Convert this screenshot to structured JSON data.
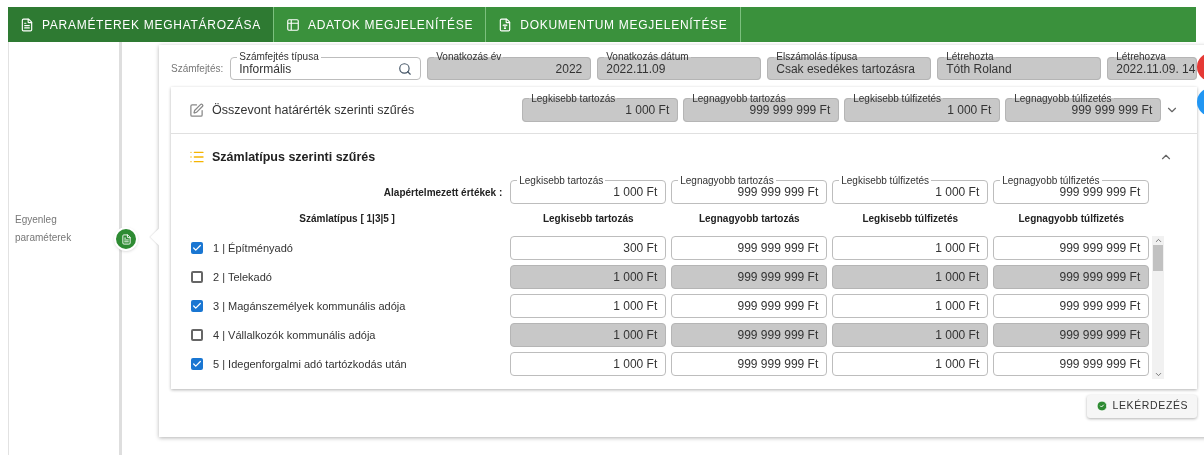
{
  "tabs": [
    {
      "label": "PARAMÉTEREK MEGHATÁROZÁSA",
      "selected": true
    },
    {
      "label": "ADATOK MEGJELENÍTÉSE",
      "selected": false
    },
    {
      "label": "DOKUMENTUM MEGJELENÍTÉSE",
      "selected": false
    }
  ],
  "sidebar": {
    "step_label": "Egyenleg paraméterek"
  },
  "header": {
    "label": "Számfejtés:",
    "fields": [
      {
        "label": "Számfejtés típusa",
        "value": "Informális",
        "disabled": false,
        "kind": "search"
      },
      {
        "label": "Vonatkozás év",
        "value": "2022",
        "disabled": true,
        "kind": "number"
      },
      {
        "label": "Vonatkozás dátum",
        "value": "2022.11.09",
        "disabled": true,
        "kind": "text"
      },
      {
        "label": "Elszámolás típusa",
        "value": "Csak esedékes tartozásra",
        "disabled": true,
        "kind": "text"
      },
      {
        "label": "Létrehozta",
        "value": "Tóth Roland",
        "disabled": true,
        "kind": "text"
      },
      {
        "label": "Létrehozva",
        "value": "2022.11.09. 14",
        "disabled": true,
        "kind": "text"
      }
    ]
  },
  "combined_filter": {
    "title": "Összevont határérték szerinti szűrés",
    "expanded": false,
    "fields": [
      {
        "label": "Legkisebb tartozás",
        "value": "1 000 Ft",
        "disabled": true
      },
      {
        "label": "Legnagyobb tartozás",
        "value": "999 999 999 Ft",
        "disabled": true
      },
      {
        "label": "Legkisebb túlfizetés",
        "value": "1 000 Ft",
        "disabled": true
      },
      {
        "label": "Legnagyobb túlfizetés",
        "value": "999 999 999 Ft",
        "disabled": true
      }
    ]
  },
  "type_filter": {
    "title": "Számlatípus szerinti szűrés",
    "expanded": true,
    "defaults_label": "Alapértelmezett értékek :",
    "defaults": [
      {
        "label": "Legkisebb tartozás",
        "value": "1 000 Ft",
        "disabled": false
      },
      {
        "label": "Legnagyobb tartozás",
        "value": "999 999 999 Ft",
        "disabled": false
      },
      {
        "label": "Legkisebb túlfizetés",
        "value": "1 000 Ft",
        "disabled": false
      },
      {
        "label": "Legnagyobb túlfizetés",
        "value": "999 999 999 Ft",
        "disabled": false
      }
    ],
    "columns": [
      "Számlatípus [ 1|3|5 ]",
      "Legkisebb tartozás",
      "Legnagyobb tartozás",
      "Legkisebb túlfizetés",
      "Legnagyobb túlfizetés"
    ],
    "rows": [
      {
        "label": "1 | Építményadó",
        "checked": true,
        "values": [
          "300 Ft",
          "999 999 999 Ft",
          "1 000 Ft",
          "999 999 999 Ft"
        ]
      },
      {
        "label": "2 | Telekadó",
        "checked": false,
        "values": [
          "1 000 Ft",
          "999 999 999 Ft",
          "1 000 Ft",
          "999 999 999 Ft"
        ]
      },
      {
        "label": "3 | Magánszemélyek kommunális adója",
        "checked": true,
        "values": [
          "1 000 Ft",
          "999 999 999 Ft",
          "1 000 Ft",
          "999 999 999 Ft"
        ]
      },
      {
        "label": "4 | Vállalkozók kommunális adója",
        "checked": false,
        "values": [
          "1 000 Ft",
          "999 999 999 Ft",
          "1 000 Ft",
          "999 999 999 Ft"
        ]
      },
      {
        "label": "5 | Idegenforgalmi adó tartózkodás után",
        "checked": true,
        "values": [
          "1 000 Ft",
          "999 999 999 Ft",
          "1 000 Ft",
          "999 999 999 Ft"
        ]
      }
    ]
  },
  "query_button": {
    "label": "LEKÉRDEZÉS"
  }
}
